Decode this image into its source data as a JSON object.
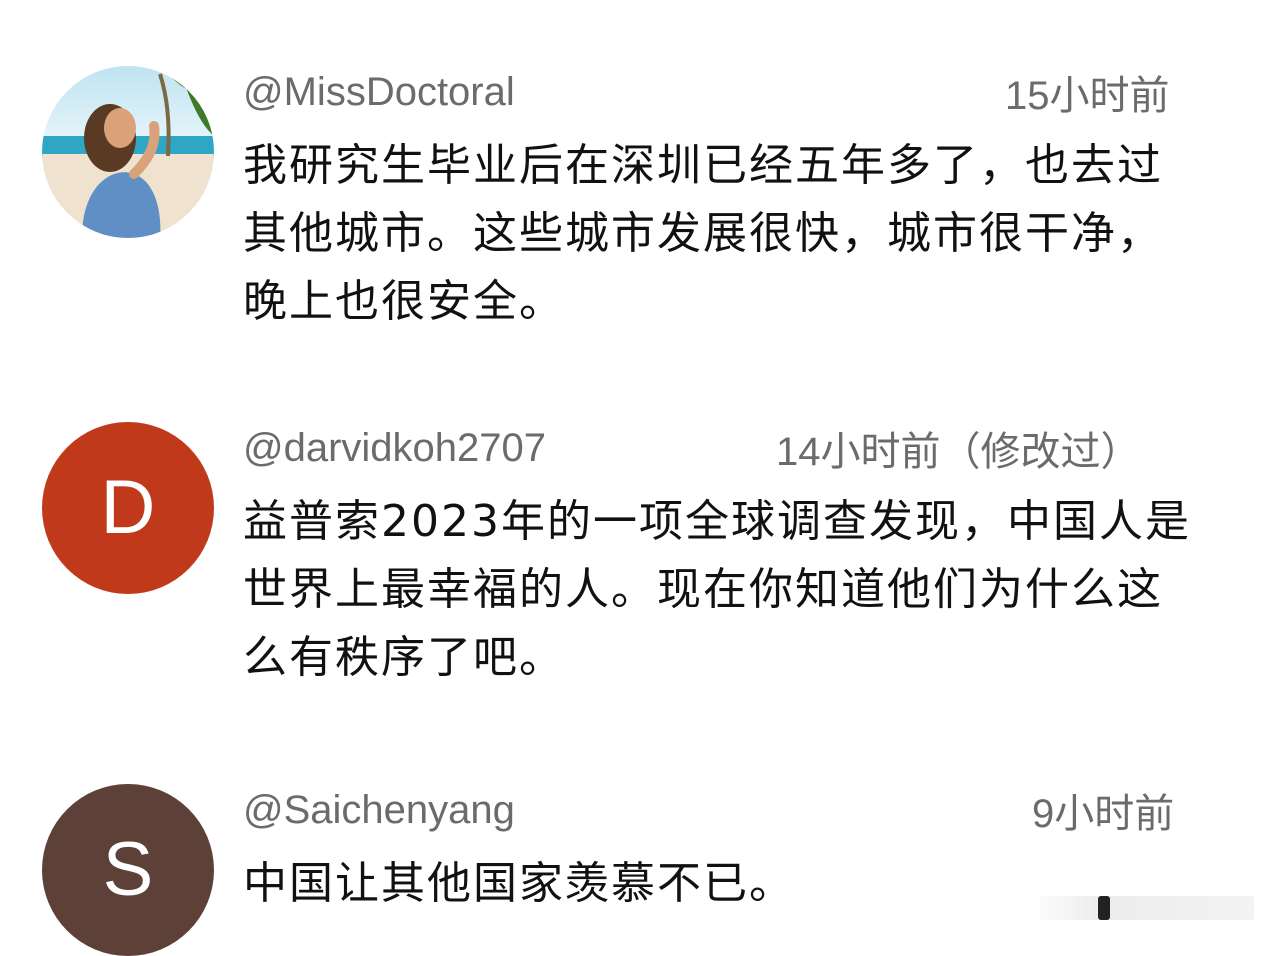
{
  "comments": [
    {
      "handle": "@MissDoctoral",
      "time": "15小时前",
      "text": "我研究生毕业后在深圳已经五年多了，也去过其他城市。这些城市发展很快，城市很干净，晚上也很安全。",
      "avatar": {
        "type": "photo"
      }
    },
    {
      "handle": "@darvidkoh2707",
      "time": "14小时前（修改过）",
      "text": "益普索2023年的一项全球调查发现，中国人是世界上最幸福的人。现在你知道他们为什么这么有秩序了吧。",
      "avatar": {
        "type": "letter",
        "letter": "D",
        "color": "#c0391a"
      }
    },
    {
      "handle": "@Saichenyang",
      "time": "9小时前",
      "text": "中国让其他国家羡慕不已。",
      "avatar": {
        "type": "letter",
        "letter": "S",
        "color": "#5d4038"
      }
    }
  ]
}
